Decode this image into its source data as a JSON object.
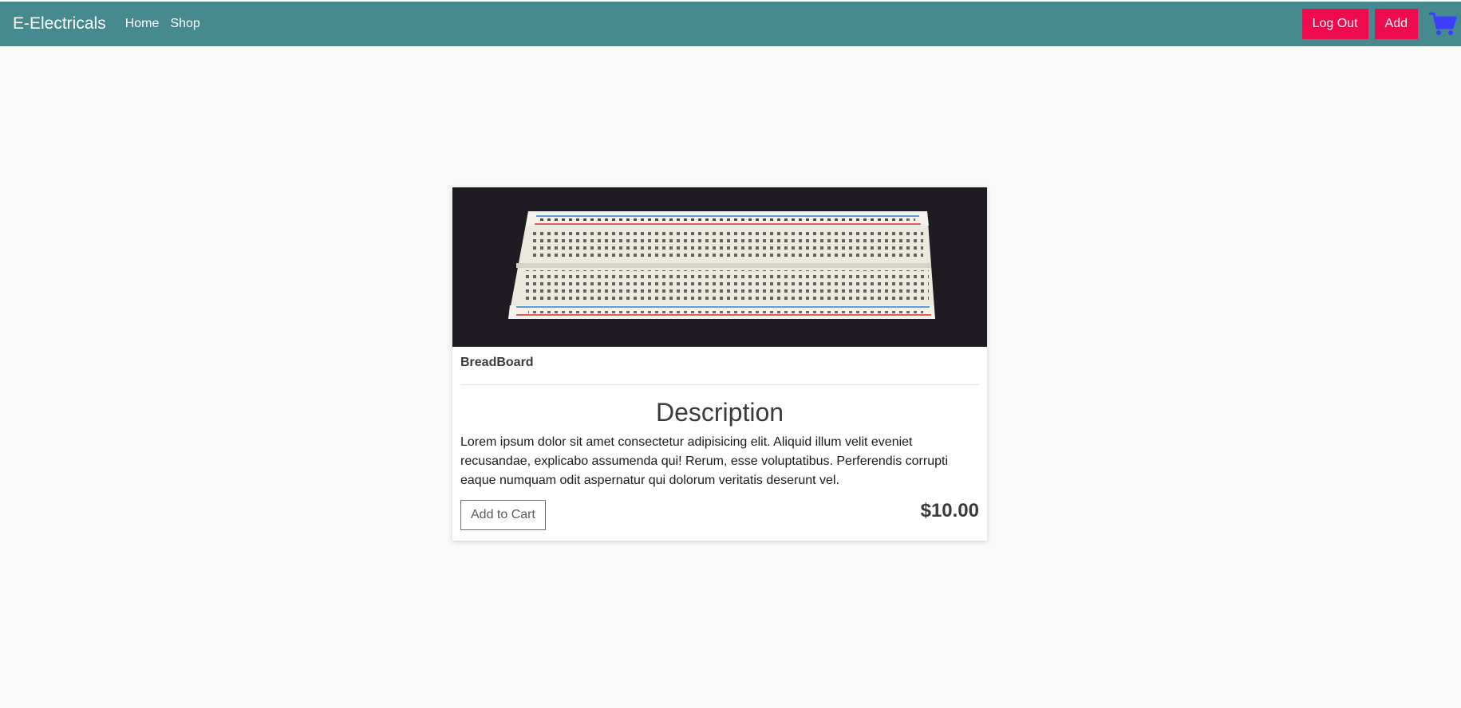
{
  "navbar": {
    "brand": "E-Electricals",
    "links": [
      "Home",
      "Shop"
    ],
    "logout_label": "Log Out",
    "add_label": "Add",
    "cart_icon": "shopping-cart-icon"
  },
  "product": {
    "image": "breadboard-photo",
    "title": "BreadBoard",
    "description_heading": "Description",
    "description": "Lorem ipsum dolor sit amet consectetur adipisicing elit. Aliquid illum velit eveniet recusandae, explicabo assumenda qui! Rerum, esse voluptatibus. Perferendis corrupti eaque numquam odit aspernatur qui dolorum veritatis deserunt vel.",
    "add_to_cart_label": "Add to Cart",
    "price": "$10.00"
  },
  "colors": {
    "navbar": "#468a8f",
    "accent_button": "#ee0a4f",
    "cart_icon": "#3d3dff",
    "page_background": "#f9f9f9"
  }
}
